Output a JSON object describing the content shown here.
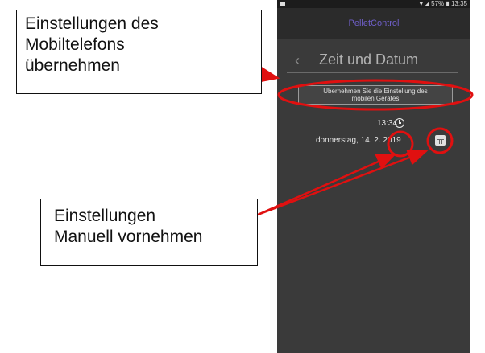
{
  "phone": {
    "status_bar": {
      "right_text": "▼◢ 57% ▮ 13:35"
    },
    "app_title": "PelletControl",
    "screen_title": "Zeit und Datum",
    "apply_button_label_line1": "Übernehmen Sie die Einstellung des",
    "apply_button_label_line2": "mobilen Gerätes",
    "time_value": "13:34",
    "date_value": "donnerstag, 14. 2. 2019"
  },
  "callouts": {
    "top_line1": "Einstellungen des",
    "top_line2": "Mobiltelefons",
    "top_line3": "übernehmen",
    "bottom_line1": "Einstellungen",
    "bottom_line2": "Manuell vornehmen"
  },
  "colors": {
    "annotation": "#e01010",
    "phone_bg": "#3a3a3a",
    "app_title": "#6f5fc8"
  },
  "icons": [
    "back-chevron-icon",
    "clock-icon",
    "calendar-icon"
  ]
}
